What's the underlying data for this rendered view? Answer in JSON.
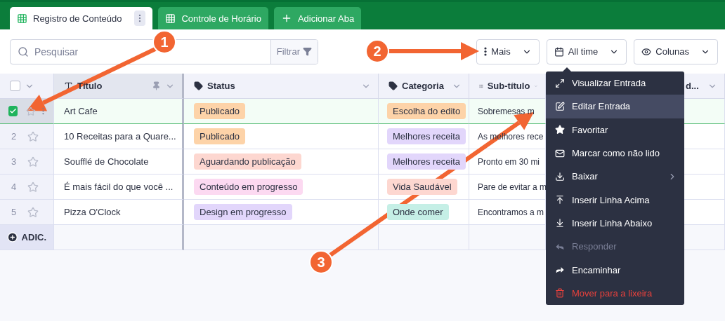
{
  "tabs": [
    {
      "label": "Registro de Conteúdo",
      "kind": "sheet",
      "selected": true
    },
    {
      "label": "Controle de Horário",
      "kind": "sheet",
      "selected": false
    },
    {
      "label": "Adicionar Aba",
      "kind": "add",
      "selected": false
    }
  ],
  "search": {
    "placeholder": "Pesquisar",
    "filter_label": "Filtrar"
  },
  "toolbar_buttons": [
    {
      "label": "Mais",
      "kind": "more"
    },
    {
      "label": "All time",
      "kind": "calendar"
    },
    {
      "label": "Colunas",
      "kind": "columns"
    }
  ],
  "table": {
    "select_all_checked": false,
    "columns": [
      {
        "label": "Título",
        "kind": "text",
        "pinned": true
      },
      {
        "label": "Status",
        "kind": "tag",
        "pinned": false
      },
      {
        "label": "Categoria",
        "kind": "tag",
        "pinned": false
      },
      {
        "label": "Sub-título",
        "kind": "longtext",
        "pinned": false
      },
      {
        "label": "d...",
        "kind": "cut",
        "pinned": false
      }
    ],
    "rows": [
      {
        "selected": true,
        "checked": true,
        "title": "Art Cafe",
        "status": {
          "label": "Publicado",
          "color": "#fdd3a8"
        },
        "category": {
          "label": "Escolha do edito",
          "color": "#fdd3a8"
        },
        "subtitle": "Sobremesas m"
      },
      {
        "selected": false,
        "checked": false,
        "number": "2",
        "title": "10 Receitas para a Quare...",
        "status": {
          "label": "Publicado",
          "color": "#fdd3a8"
        },
        "category": {
          "label": "Melhores receita",
          "color": "#e2d6fb"
        },
        "subtitle": "As melhores rece"
      },
      {
        "selected": false,
        "checked": false,
        "number": "3",
        "title": "Soufflé de Chocolate",
        "status": {
          "label": "Aguardando publicação",
          "color": "#fdd7d0"
        },
        "category": {
          "label": "Melhores receita",
          "color": "#e2d6fb"
        },
        "subtitle": "Pronto em 30 mi"
      },
      {
        "selected": false,
        "checked": false,
        "number": "4",
        "title": "É mais fácil do que você ...",
        "status": {
          "label": "Conteúdo em progresso",
          "color": "#fcd9f1"
        },
        "category": {
          "label": "Vida Saudável",
          "color": "#fdd7d0"
        },
        "subtitle": "Pare de evitar a m"
      },
      {
        "selected": false,
        "checked": false,
        "number": "5",
        "title": "Pizza O'Clock",
        "status": {
          "label": "Design em progresso",
          "color": "#e2d6fb"
        },
        "category": {
          "label": "Onde comer",
          "color": "#c5efe6"
        },
        "subtitle": "Encontramos a m"
      }
    ],
    "add_label": "ADIC."
  },
  "context_menu": [
    {
      "label": "Visualizar Entrada",
      "kind": "view",
      "selected": false,
      "disabled": false,
      "submenu": false
    },
    {
      "label": "Editar Entrada",
      "kind": "edit",
      "selected": true,
      "disabled": false,
      "submenu": false
    },
    {
      "label": "Favoritar",
      "kind": "star",
      "selected": false,
      "disabled": false,
      "submenu": false
    },
    {
      "label": "Marcar como não lido",
      "kind": "mail",
      "selected": false,
      "disabled": false,
      "submenu": false
    },
    {
      "label": "Baixar",
      "kind": "download",
      "selected": false,
      "disabled": false,
      "submenu": true
    },
    {
      "label": "Inserir Linha Acima",
      "kind": "insert-above",
      "selected": false,
      "disabled": false,
      "submenu": false
    },
    {
      "label": "Inserir Linha Abaixo",
      "kind": "insert-below",
      "selected": false,
      "disabled": false,
      "submenu": false
    },
    {
      "label": "Responder",
      "kind": "reply",
      "selected": false,
      "disabled": true,
      "submenu": false
    },
    {
      "label": "Encaminhar",
      "kind": "forward",
      "selected": false,
      "disabled": false,
      "submenu": false
    },
    {
      "label": "Mover para a lixeira",
      "kind": "delete",
      "selected": false,
      "disabled": false,
      "submenu": false
    }
  ],
  "annotations": [
    {
      "label": "1"
    },
    {
      "label": "2"
    },
    {
      "label": "3"
    }
  ]
}
